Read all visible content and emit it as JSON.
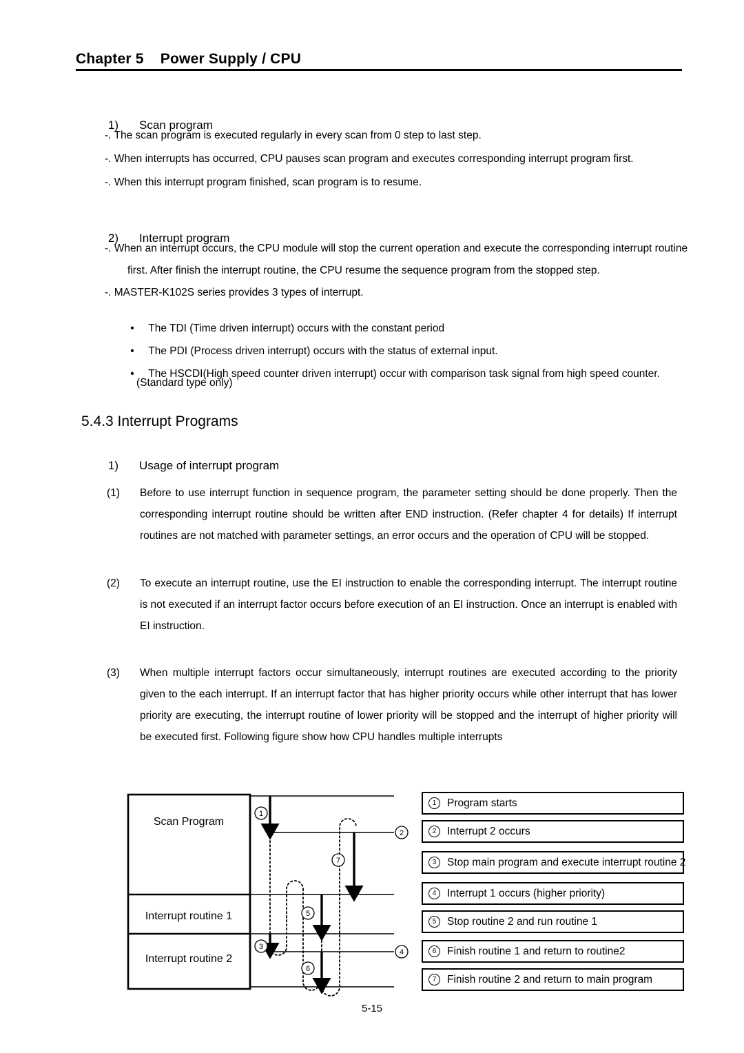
{
  "header": {
    "chapter_label": "Chapter 5",
    "chapter_title": "Power Supply / CPU",
    "combined": "Chapter 5    Power Supply / CPU"
  },
  "section_scan": {
    "number": "1)",
    "title": "Scan program",
    "items": [
      "-. The scan program is executed regularly in every scan from 0 step to last step.",
      "-. When interrupts has occurred, CPU pauses scan program and executes corresponding interrupt program first.",
      "-. When this interrupt program finished, scan program is to resume."
    ]
  },
  "section_interrupt": {
    "number": "2)",
    "title": "Interrupt program",
    "items": [
      "-. When an interrupt occurs, the CPU module will stop the current operation and execute the corresponding interrupt routine",
      "first. After finish the interrupt routine, the CPU resume the sequence program from the stopped step.",
      "-. MASTER-K102S series provides 3 types of interrupt."
    ],
    "bullets": [
      "The TDI (Time driven interrupt) occurs with the constant period",
      "The PDI (Process driven interrupt) occurs with the status of external input.",
      "The HSCDI(High speed counter driven interrupt) occur with comparison task signal from high speed counter.",
      "(Standard type only)"
    ],
    "bullet_glyph": "•"
  },
  "section_543": {
    "heading": "5.4.3 Interrupt Programs",
    "sub_number": "1)",
    "sub_title": "Usage of interrupt program",
    "paragraphs": [
      {
        "num": "(1)",
        "text": "Before to use interrupt function in sequence program, the parameter setting should be done properly. Then the corresponding interrupt routine should be written after END instruction. (Refer chapter 4 for details) If interrupt routines are not matched with parameter settings, an error occurs and the operation of CPU will be stopped."
      },
      {
        "num": "(2)",
        "text": "To execute an interrupt routine, use the EI instruction to enable the corresponding interrupt. The interrupt routine is not executed if an interrupt factor occurs before execution of an EI instruction. Once an interrupt is enabled with EI instruction."
      },
      {
        "num": "(3)",
        "text": "When multiple interrupt factors occur simultaneously, interrupt routines are executed according to the priority given to the each interrupt. If an interrupt factor that has higher priority occurs while other interrupt that has lower priority are executing, the interrupt routine of lower priority will be stopped and the interrupt of higher priority will be executed first. Following figure show how CPU handles multiple interrupts"
      }
    ]
  },
  "figure": {
    "row_labels": [
      "Scan Program",
      "Interrupt routine 1",
      "Interrupt routine 2"
    ],
    "markers": [
      "1",
      "2",
      "3",
      "4",
      "5",
      "6",
      "7"
    ],
    "legend": [
      {
        "num": "①",
        "text": "Program starts"
      },
      {
        "num": "②",
        "text": "Interrupt 2 occurs"
      },
      {
        "num": "③",
        "text": "Stop main program and execute interrupt routine 2"
      },
      {
        "num": "④",
        "text": "Interrupt 1 occurs (higher priority)"
      },
      {
        "num": "⑤",
        "text": "Stop routine 2 and run routine 1"
      },
      {
        "num": "⑥",
        "text": "Finish routine 1 and return to routine2"
      },
      {
        "num": "⑦",
        "text": "Finish routine 2 and return to main program"
      }
    ],
    "legend_nums": [
      "1",
      "2",
      "3",
      "4",
      "5",
      "6",
      "7"
    ]
  },
  "footer": {
    "page_number": "5-15"
  },
  "colors": {
    "text": "#000000",
    "background": "#ffffff",
    "rule": "#000000"
  }
}
